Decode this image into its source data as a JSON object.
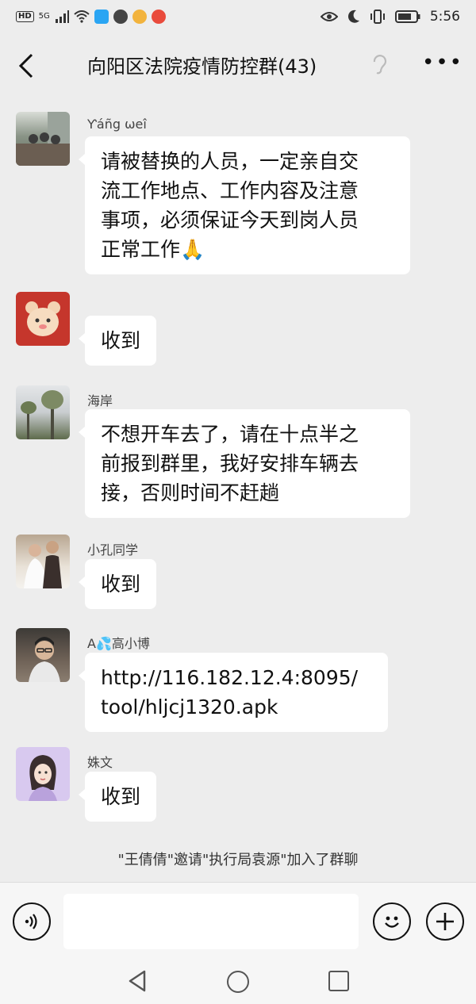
{
  "status_bar": {
    "hd": "HD",
    "network": "5G",
    "time": "5:56"
  },
  "header": {
    "title": "向阳区法院疫情防控群(43)",
    "back_icon": "chevron-left-icon",
    "more_icon": "more-dots-icon",
    "more_label": "•••"
  },
  "messages": [
    {
      "sender": "Ƴáñg ωeî",
      "text_lines": [
        "请被替换的人员，一定亲自交",
        "流工作地点、工作内容及注意",
        "事项，必须保证今天到岗人员",
        "正常工作🙏"
      ]
    },
    {
      "sender": "",
      "text_lines": [
        "收到"
      ]
    },
    {
      "sender": "海岸",
      "text_lines": [
        "不想开车去了，请在十点半之",
        "前报到群里，我好安排车辆去",
        "接，否则时间不赶趟"
      ]
    },
    {
      "sender": "小孔同学",
      "text_lines": [
        "收到"
      ]
    },
    {
      "sender": "A💦高小博",
      "text_lines": [
        "http://116.182.12.4:8095/",
        "tool/hljcj1320.apk"
      ]
    },
    {
      "sender": "姝文",
      "text_lines": [
        "收到"
      ]
    }
  ],
  "system_note": "\"王倩倩\"邀请\"执行局袁源\"加入了群聊",
  "input_bar": {
    "placeholder": "",
    "voice_icon": "voice-icon",
    "emoji_icon": "emoji-icon",
    "plus_label": "+"
  },
  "colors": {
    "background": "#ededed",
    "bubble": "#ffffff",
    "bar": "#f6f6f6"
  }
}
